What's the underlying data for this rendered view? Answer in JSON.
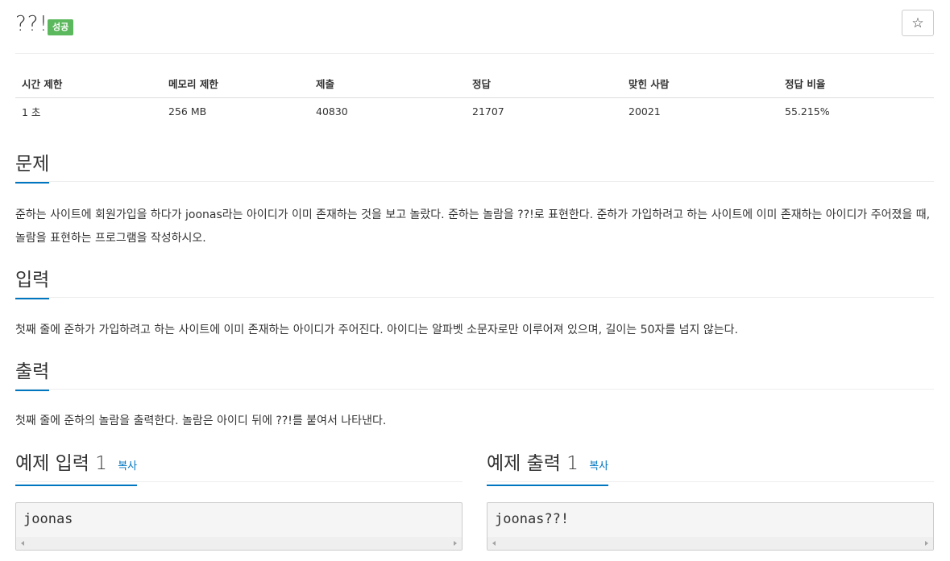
{
  "problem": {
    "title": "??!",
    "status_badge": "성공",
    "star_icon": "☆"
  },
  "info_table": {
    "headers": [
      "시간 제한",
      "메모리 제한",
      "제출",
      "정답",
      "맞힌 사람",
      "정답 비율"
    ],
    "values": [
      "1 초",
      "256 MB",
      "40830",
      "21707",
      "20021",
      "55.215%"
    ]
  },
  "sections": {
    "problem": {
      "heading": "문제",
      "text": "준하는 사이트에 회원가입을 하다가 joonas라는 아이디가 이미 존재하는 것을 보고 놀랐다. 준하는 놀람을 ??!로 표현한다. 준하가 가입하려고 하는 사이트에 이미 존재하는 아이디가 주어졌을 때, 놀람을 표현하는 프로그램을 작성하시오."
    },
    "input": {
      "heading": "입력",
      "text": "첫째 줄에 준하가 가입하려고 하는 사이트에 이미 존재하는 아이디가 주어진다. 아이디는 알파벳 소문자로만 이루어져 있으며, 길이는 50자를 넘지 않는다."
    },
    "output": {
      "heading": "출력",
      "text": "첫째 줄에 준하의 놀람을 출력한다. 놀람은 아이디 뒤에 ??!를 붙여서 나타낸다."
    }
  },
  "samples": {
    "input": {
      "heading": "예제 입력 1",
      "copy": "복사",
      "content": "joonas"
    },
    "output": {
      "heading": "예제 출력 1",
      "copy": "복사",
      "content": "joonas??!"
    }
  },
  "colors": {
    "accent": "#0076c0",
    "success": "#5cb85c"
  }
}
